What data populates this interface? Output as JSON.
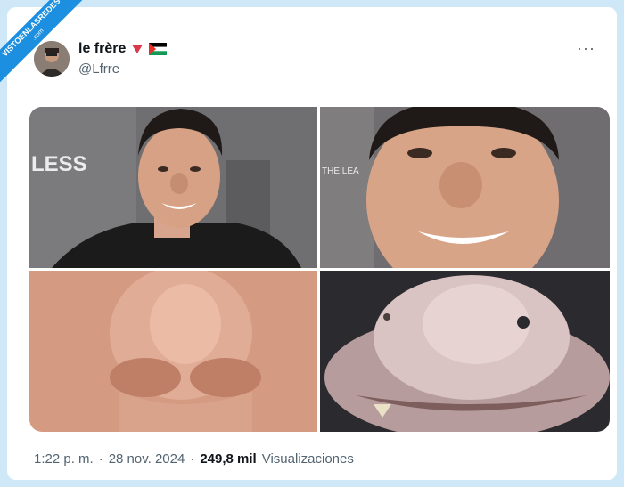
{
  "watermark": {
    "text": "VISTOENLASREDES",
    "sub": ".com"
  },
  "author": {
    "name": "le frère",
    "handle": "@Lfrre"
  },
  "menu": {
    "more_label": "···"
  },
  "photos": {
    "backdrop_text_1": "LESS",
    "backdrop_text_2": "THE LEA"
  },
  "footer": {
    "time": "1:22 p. m.",
    "separator": "·",
    "date": "28 nov. 2024",
    "views_count": "249,8 mil",
    "views_label": "Visualizaciones"
  }
}
